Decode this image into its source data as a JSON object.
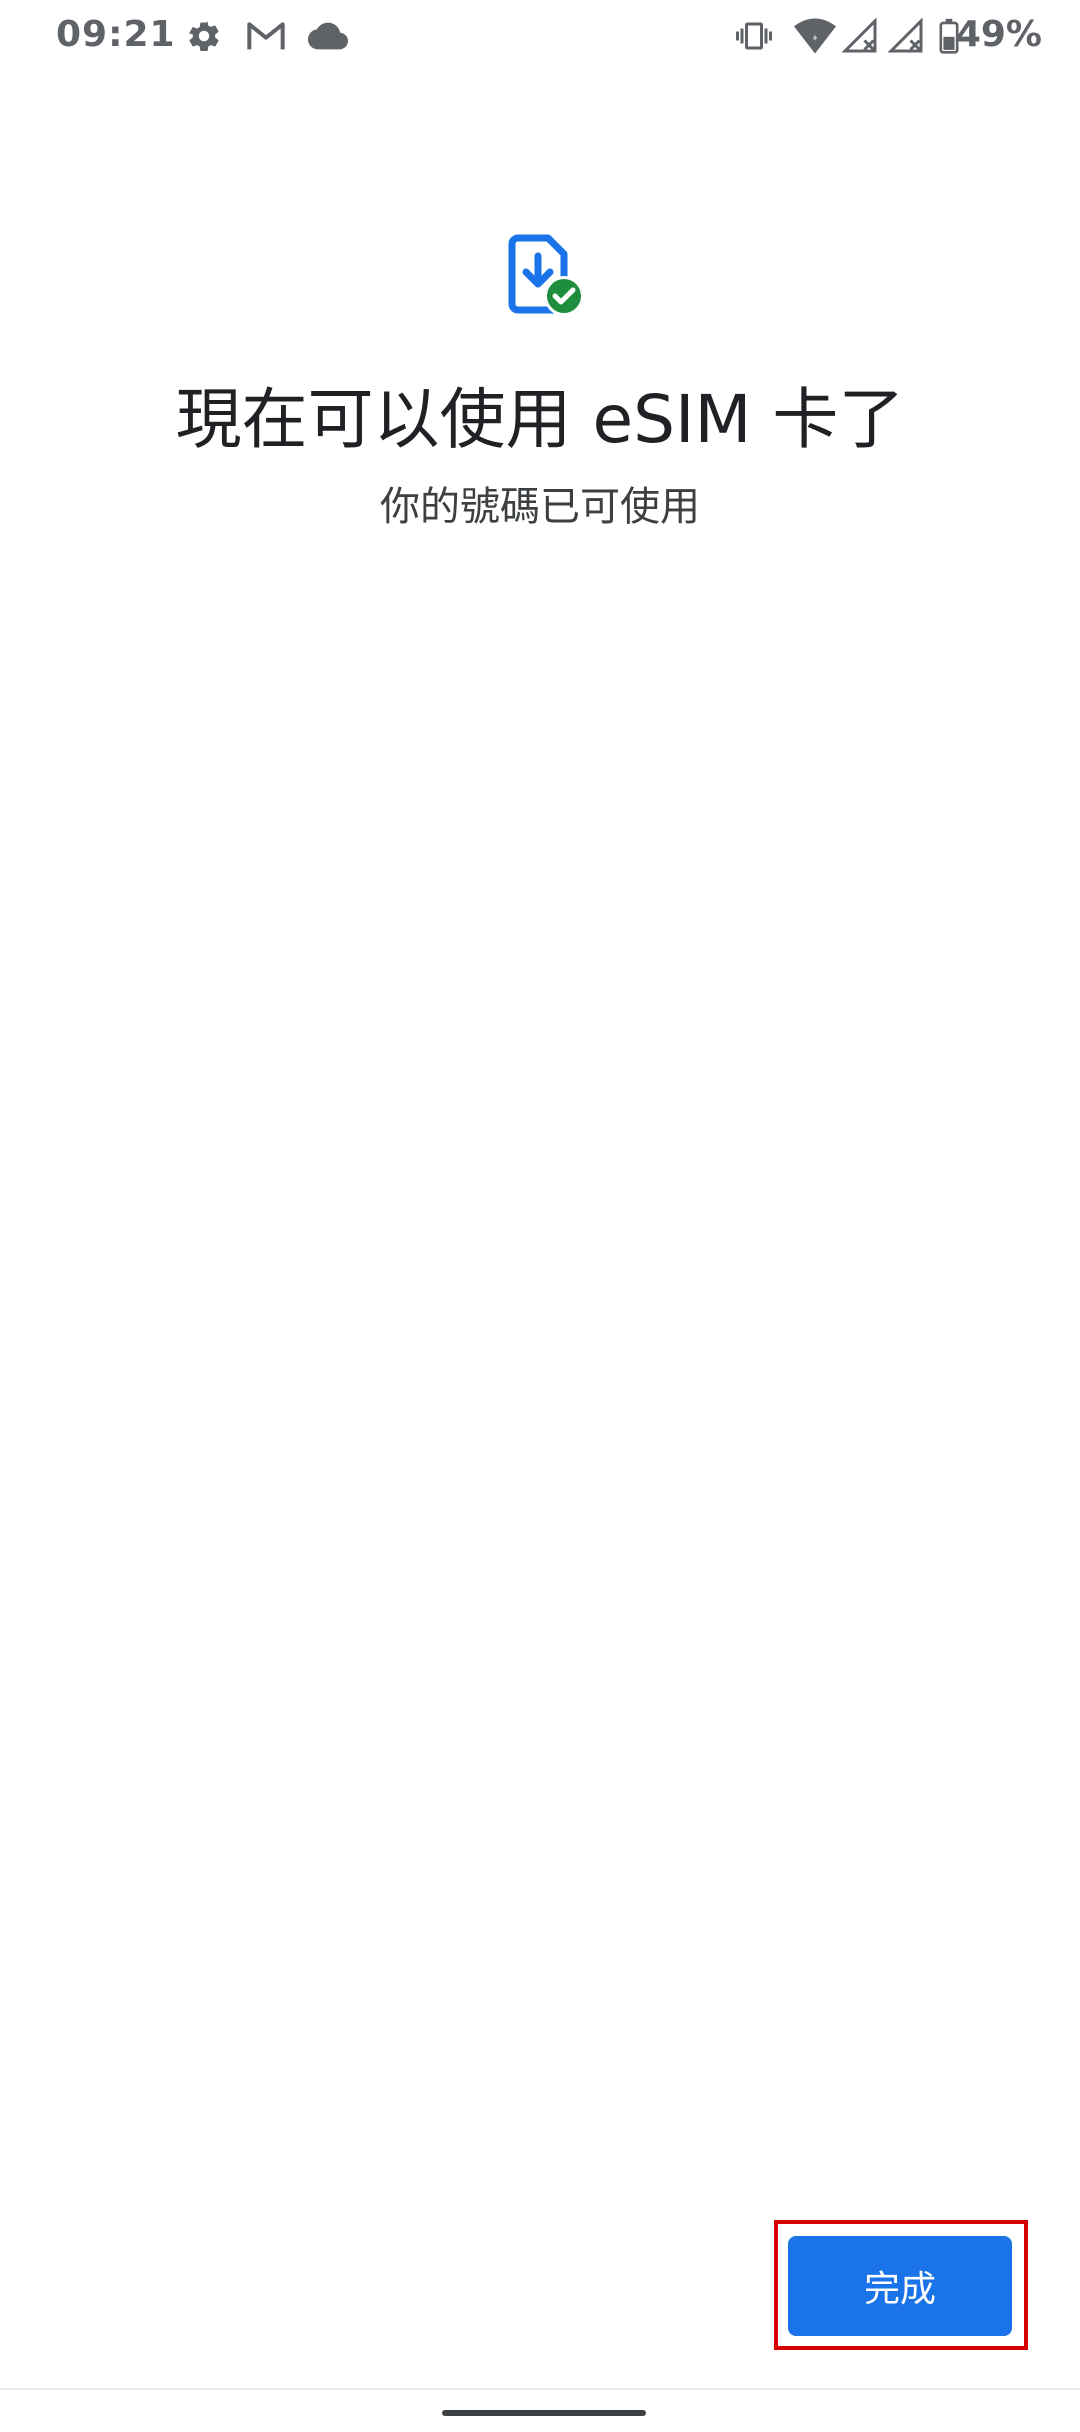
{
  "status_bar": {
    "time": "09:21",
    "icons_left": [
      "gear-icon",
      "gmail-icon",
      "cloud-icon"
    ],
    "icons_right": [
      "vibrate-icon",
      "wifi-icon",
      "signal-no-service-icon",
      "signal-no-service-icon",
      "battery-icon"
    ],
    "battery": "49%"
  },
  "content": {
    "icon": "esim-download-check-icon",
    "title": "現在可以使用 eSIM 卡了",
    "subtitle": "你的號碼已可使用"
  },
  "footer": {
    "done_label": "完成"
  },
  "colors": {
    "primary": "#1a73e8",
    "success": "#1e8e3e",
    "highlight": "#d50000"
  }
}
